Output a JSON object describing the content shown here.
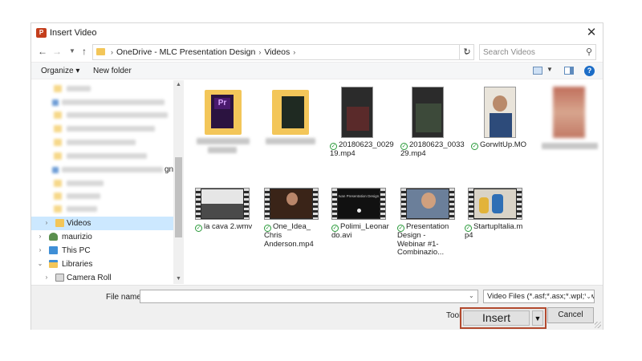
{
  "dialog": {
    "title": "Insert Video",
    "app_icon_text": "P"
  },
  "nav": {
    "breadcrumbs": [
      "OneDrive - MLC Presentation Design",
      "Videos"
    ],
    "search_placeholder": "Search Videos"
  },
  "toolbar": {
    "organize": "Organize ▾",
    "new_folder": "New folder",
    "help": "?"
  },
  "sidebar": {
    "partial_text": "gn",
    "items": [
      {
        "label": "Videos",
        "selected": true,
        "icon": "folder-icon"
      },
      {
        "label": "maurizio",
        "icon": "user-icon"
      },
      {
        "label": "This PC",
        "icon": "computer-icon"
      },
      {
        "label": "Libraries",
        "icon": "libraries-icon"
      },
      {
        "label": "Camera Roll",
        "icon": "library-folder-icon"
      }
    ]
  },
  "files": {
    "row1": [
      {
        "name": "20180623_0029\n19.mp4"
      },
      {
        "name": "20180623_0033\n29.mp4"
      },
      {
        "name": "GorwItUp.MO"
      }
    ],
    "row2": [
      {
        "name": "la cava 2.wmv"
      },
      {
        "name": "One_Idea_\nChris\nAnderson.mp4"
      },
      {
        "name": "Polimi_Leonar\ndo.avi",
        "thumb_text": "Ivan Presentation Design"
      },
      {
        "name": "Presentation\nDesign -\nWebinar #1-\nCombinazio..."
      },
      {
        "name": "StartupItalia.m\np4"
      }
    ]
  },
  "footer": {
    "file_name_label": "File name:",
    "file_name_value": "",
    "file_type": "Video Files (*.asf;*.asx;*.wpl;*.w",
    "tools": "Tools",
    "insert": "Insert",
    "cancel": "Cancel"
  },
  "colors": {
    "accent_outline": "#b2492e",
    "selection": "#cce8ff",
    "sync_check": "#2a9a3a"
  }
}
